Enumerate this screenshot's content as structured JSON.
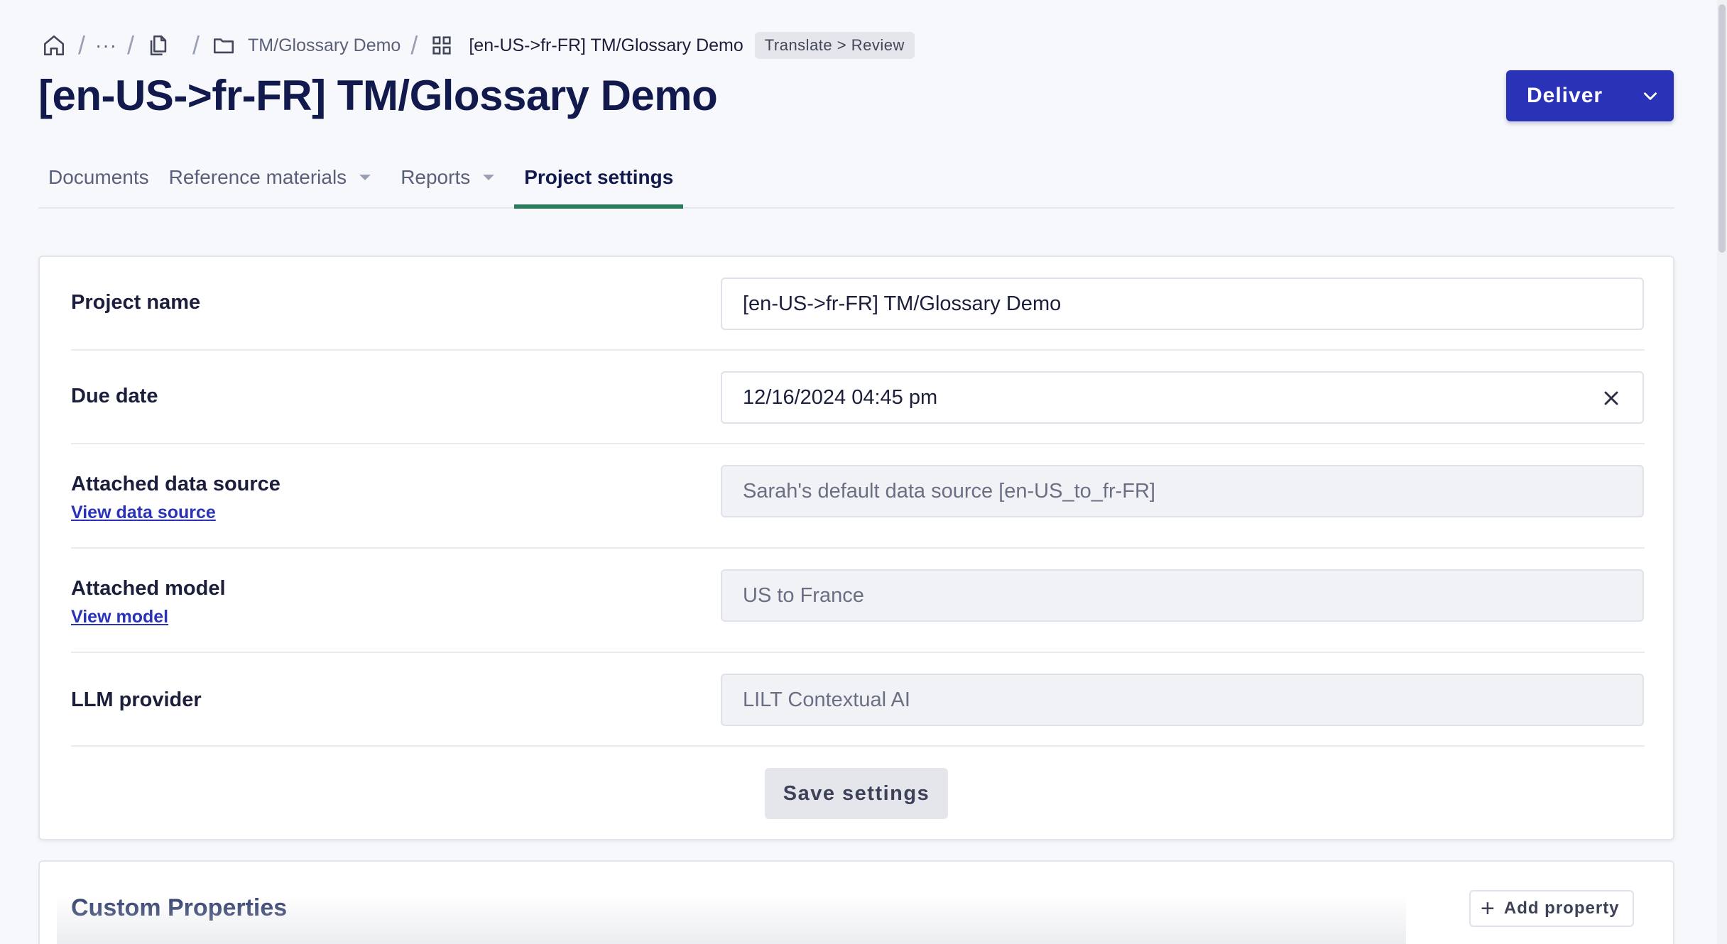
{
  "breadcrumb": {
    "ellipsis": "···",
    "folder": "TM/Glossary Demo",
    "project": "[en-US->fr-FR] TM/Glossary Demo",
    "workflow_badge": "Translate > Review",
    "icons": [
      "home-icon",
      "documents-icon",
      "folder-icon",
      "grid-icon"
    ]
  },
  "header": {
    "title": "[en-US->fr-FR] TM/Glossary Demo",
    "deliver_label": "Deliver"
  },
  "tabs": [
    {
      "label": "Documents"
    },
    {
      "label": "Reference materials"
    },
    {
      "label": "Reports"
    },
    {
      "label": "Project settings"
    }
  ],
  "settings": {
    "project_name_label": "Project name",
    "project_name_value": "[en-US->fr-FR] TM/Glossary Demo",
    "due_date_label": "Due date",
    "due_date_value": "12/16/2024 04:45 pm",
    "data_source_label": "Attached data source",
    "data_source_link": "View data source",
    "data_source_value": "Sarah's default data source [en-US_to_fr-FR]",
    "model_label": "Attached model",
    "model_link": "View model",
    "model_value": "US to France",
    "llm_label": "LLM provider",
    "llm_value": "LILT Contextual AI",
    "save_label": "Save settings"
  },
  "custom_properties": {
    "title": "Custom Properties",
    "add_label": "Add property"
  },
  "colors": {
    "accent": "#2a33b8",
    "active_tab": "#2a7a5b",
    "title": "#121a4d"
  }
}
